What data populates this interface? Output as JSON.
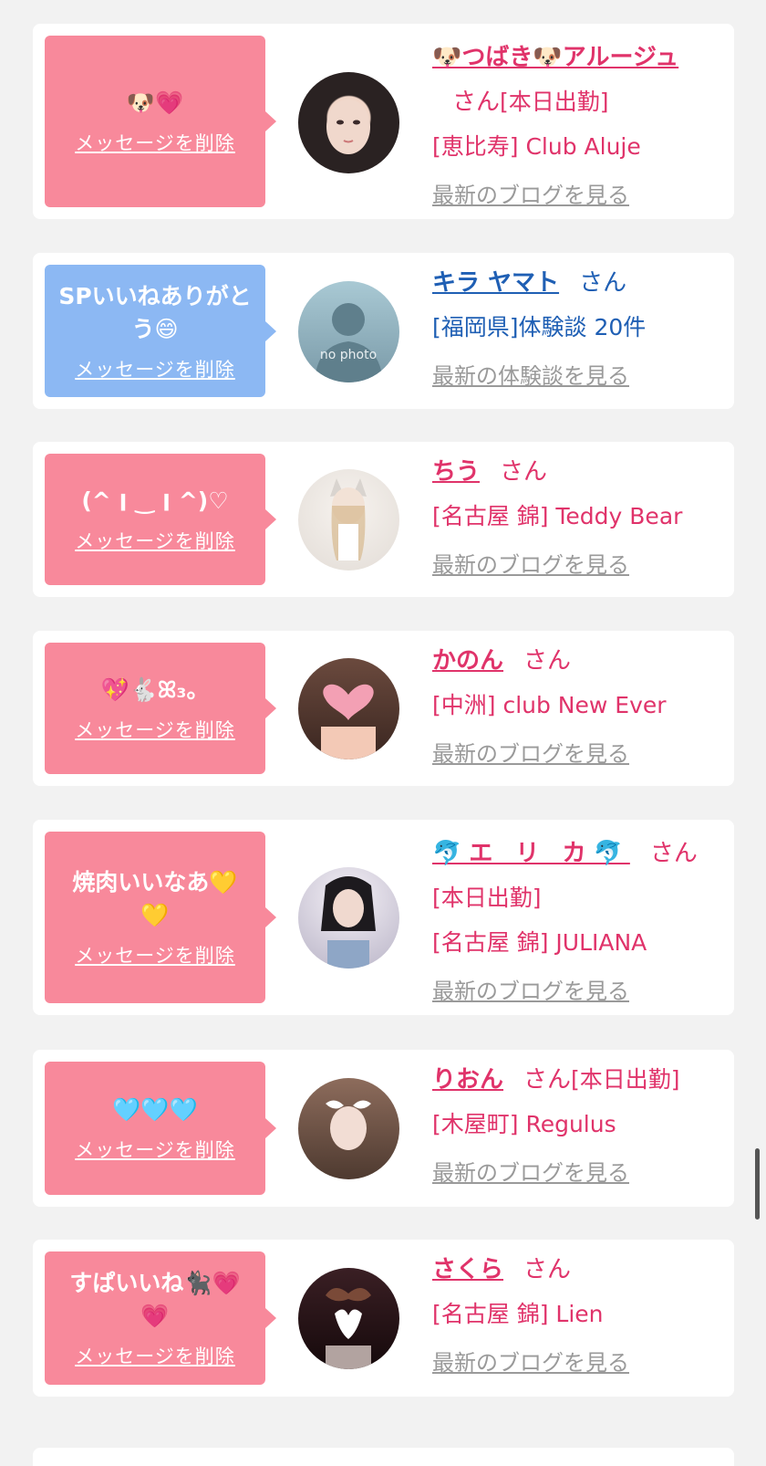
{
  "items": [
    {
      "message": "🐶💗",
      "delete_label": "メッセージを削除",
      "name": "🐶つばき🐶アルージュ",
      "honorific": "さん",
      "status": "[本日出勤]",
      "shop": "[恵比寿] Club Aluje",
      "link": "最新のブログを見る",
      "bubble_color": "#f8899b"
    },
    {
      "message": "SPいいねありがとう😄",
      "delete_label": "メッセージを削除",
      "name": "キラ ヤマト",
      "honorific": "さん",
      "status": "",
      "shop": "[福岡県]体験談 20件",
      "link": "最新の体験談を見る",
      "avatar_text": "no photo",
      "bubble_color": "#8cb8f3"
    },
    {
      "message": "(^ ׀ ‿ ׀ ^)♡",
      "delete_label": "メッセージを削除",
      "name": "ちう",
      "honorific": "さん",
      "status": "",
      "shop": "[名古屋 錦] Teddy Bear",
      "link": "最新のブログを見る",
      "bubble_color": "#f8899b"
    },
    {
      "message": "💖🐇ꕤ₃。",
      "delete_label": "メッセージを削除",
      "name": "かのん",
      "honorific": "さん",
      "status": "",
      "shop": "[中洲] club New Ever",
      "link": "最新のブログを見る",
      "bubble_color": "#f8899b"
    },
    {
      "message": "焼肉いいなあ💛💛",
      "delete_label": "メッセージを削除",
      "name": "🐬エ リ カ🐬",
      "honorific": "さん",
      "status": "[本日出勤]",
      "shop": "[名古屋 錦] JULIANA",
      "link": "最新のブログを見る",
      "bubble_color": "#f8899b"
    },
    {
      "message": "🩵🩵🩵",
      "delete_label": "メッセージを削除",
      "name": "りおん",
      "honorific": "さん",
      "status": "[本日出勤]",
      "shop": "[木屋町] Regulus",
      "link": "最新のブログを見る",
      "bubble_color": "#f8899b"
    },
    {
      "message": "すぱいいね🐈‍⬛💗💗",
      "delete_label": "メッセージを削除",
      "name": "さくら",
      "honorific": "さん",
      "status": "",
      "shop": "[名古屋 錦] Lien",
      "link": "最新のブログを見る",
      "bubble_color": "#f8899b"
    }
  ]
}
